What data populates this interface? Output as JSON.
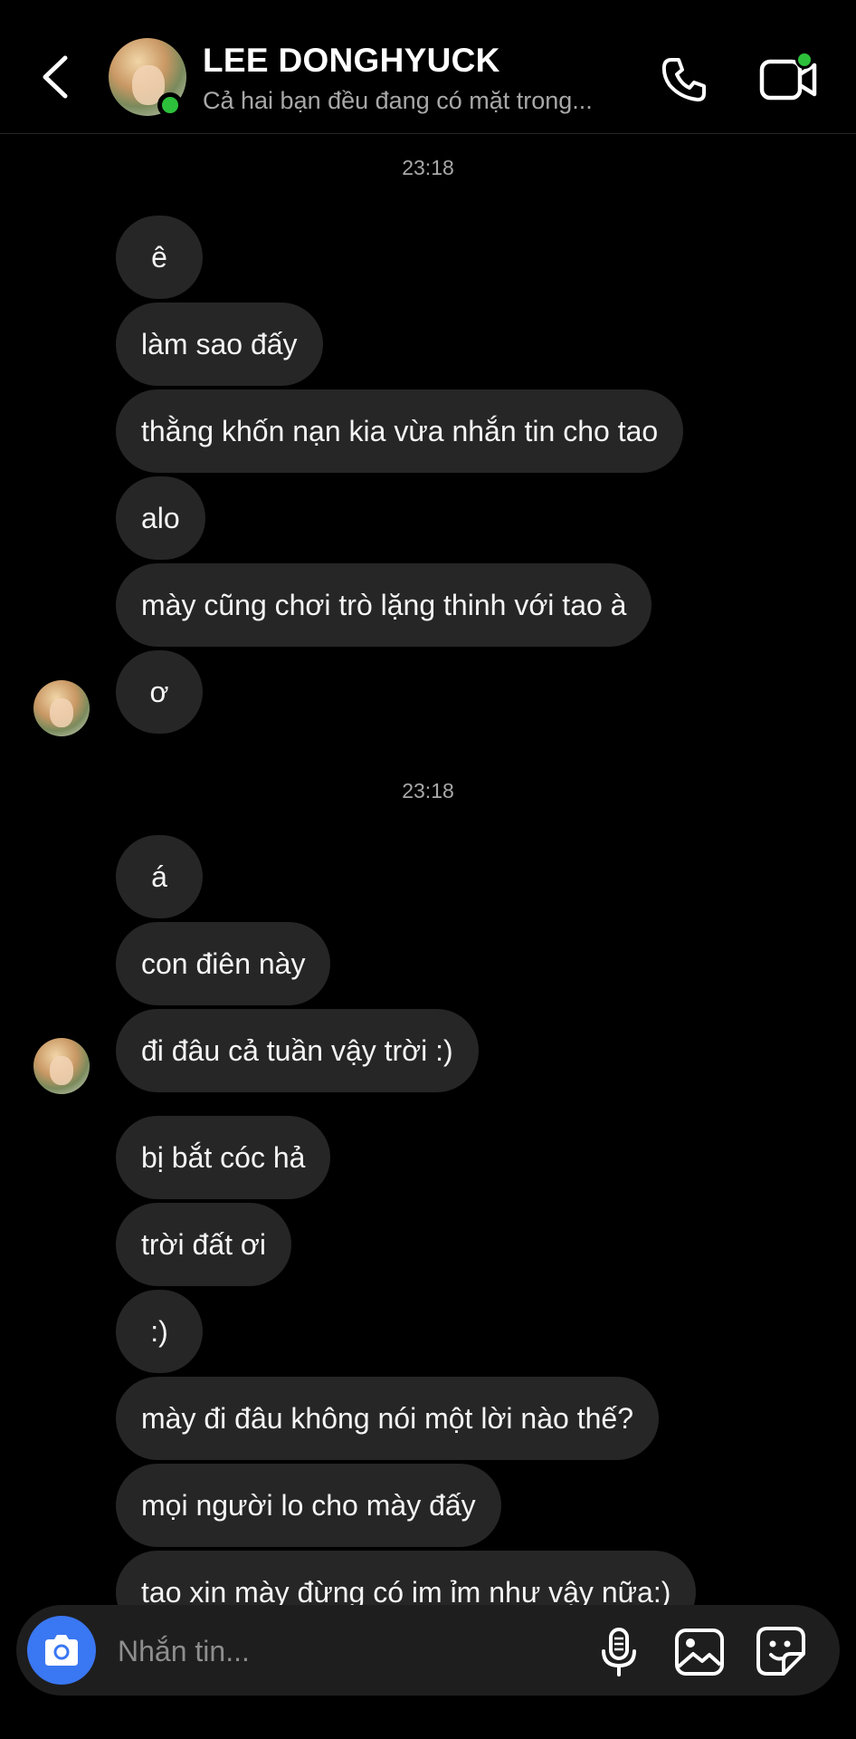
{
  "header": {
    "name": "LEE DONGHYUCK",
    "status": "Cả hai bạn đều đang có mặt trong..."
  },
  "icons": {
    "back": "chevron-left-icon",
    "call": "phone-icon",
    "video": "video-call-icon",
    "camera": "camera-icon",
    "mic": "microphone-icon",
    "gallery": "image-icon",
    "sticker": "sticker-icon"
  },
  "colors": {
    "background": "#000000",
    "bubble": "#262626",
    "online": "#2dc13b",
    "camera_button": "#3a77f2",
    "secondary_text": "#a8a8a8"
  },
  "timestamps": [
    "23:18",
    "23:18"
  ],
  "messages": [
    "ê",
    "làm sao đấy",
    "thằng khốn nạn kia vừa nhắn tin cho tao",
    "alo",
    "mày cũng chơi trò lặng thinh với tao à",
    "ơ",
    "á",
    "con điên này",
    "đi đâu cả tuần vậy trời :)",
    "bị bắt cóc hả",
    "trời đất ơi",
    ":)",
    "mày đi đâu không nói một lời nào thế?",
    "mọi người lo cho mày đấy",
    "tao xin mày đừng có im ỉm như vậy nữa:)"
  ],
  "composer": {
    "placeholder": "Nhắn tin..."
  }
}
